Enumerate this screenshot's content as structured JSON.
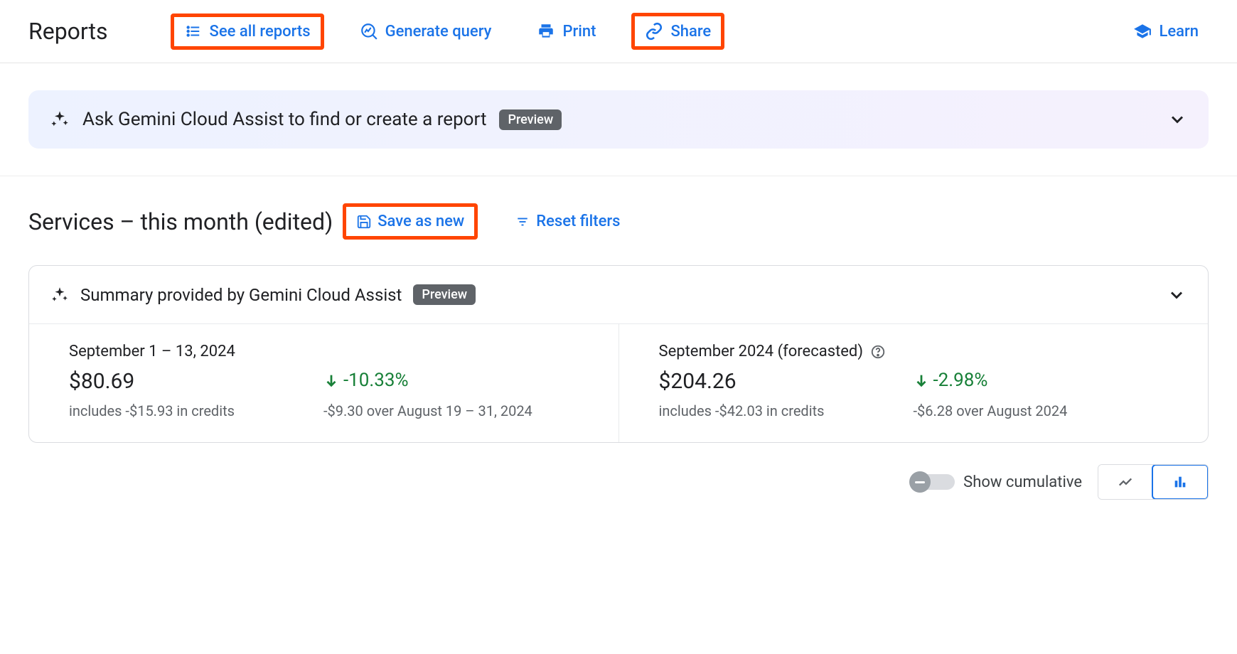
{
  "header": {
    "title": "Reports",
    "see_all_reports": "See all reports",
    "generate_query": "Generate query",
    "print": "Print",
    "share": "Share",
    "learn": "Learn"
  },
  "gemini_banner": {
    "text": "Ask Gemini Cloud Assist to find or create a report",
    "badge": "Preview"
  },
  "report": {
    "title": "Services – this month (edited)",
    "save_as_new": "Save as new",
    "reset_filters": "Reset filters"
  },
  "summary": {
    "title": "Summary provided by Gemini Cloud Assist",
    "badge": "Preview",
    "current": {
      "period": "September 1 – 13, 2024",
      "amount": "$80.69",
      "delta": "-10.33%",
      "credits": "includes -$15.93 in credits",
      "compare": "-$9.30 over August 19 – 31, 2024"
    },
    "forecast": {
      "period": "September 2024 (forecasted)",
      "amount": "$204.26",
      "delta": "-2.98%",
      "credits": "includes -$42.03 in credits",
      "compare": "-$6.28 over August 2024"
    }
  },
  "footer": {
    "show_cumulative": "Show cumulative"
  },
  "colors": {
    "link": "#1a73e8",
    "positive": "#188038",
    "highlight": "#ff4500"
  }
}
